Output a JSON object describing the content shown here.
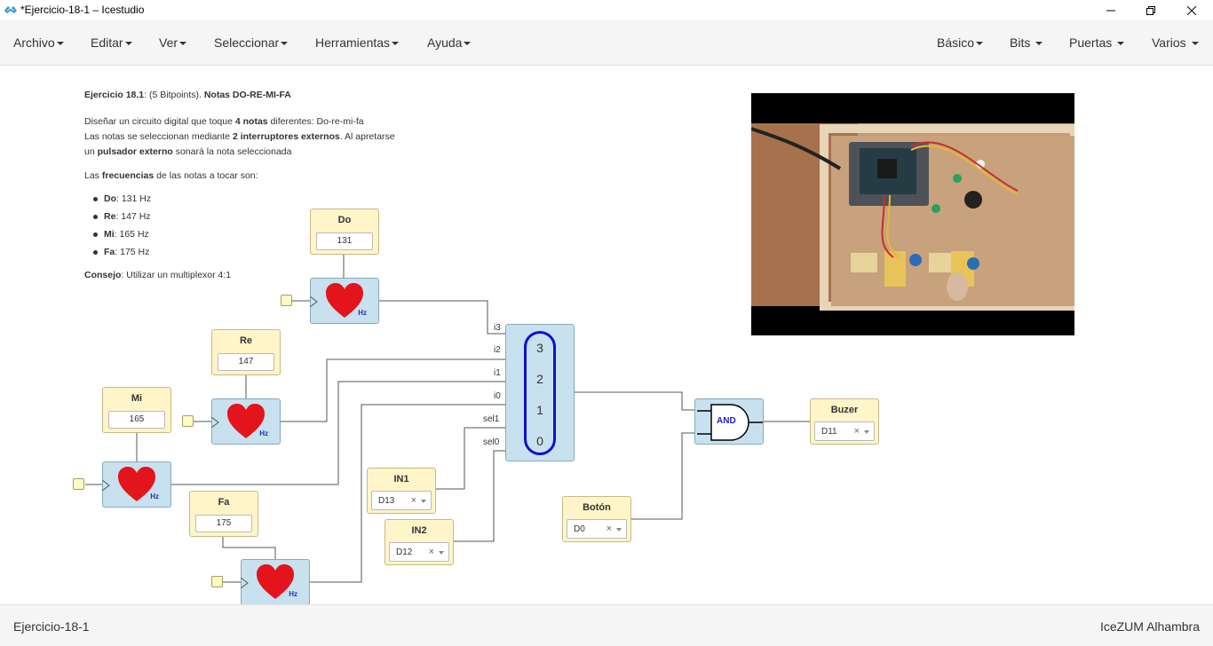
{
  "window": {
    "title": "*Ejercicio-18-1 – Icestudio"
  },
  "menubar": {
    "left": [
      "Archivo",
      "Editar",
      "Ver",
      "Seleccionar",
      "Herramientas",
      "Ayuda"
    ],
    "right": [
      "Básico",
      "Bits",
      "Puertas",
      "Varios"
    ]
  },
  "info": {
    "title_prefix": "Ejercicio 18.1",
    "title_mid": ": (5 Bitpoints). ",
    "title_suffix": "Notas DO-RE-MI-FA",
    "p1_a": "Diseñar un circuito digital que toque ",
    "p1_b": "4 notas",
    "p1_c": " diferentes: Do-re-mi-fa",
    "p2_a": "Las notas se seleccionan mediante ",
    "p2_b": "2 interruptores externos",
    "p2_c": ". Al apretarse",
    "p3_a": "un ",
    "p3_b": "pulsador externo",
    "p3_c": " sonará la nota seleccionada",
    "freq_a": "Las ",
    "freq_b": "frecuencias",
    "freq_c": " de las notas a tocar son:",
    "notes": [
      {
        "name": "Do",
        "freq": ": 131 Hz"
      },
      {
        "name": "Re",
        "freq": ": 147 Hz"
      },
      {
        "name": "Mi",
        "freq": ": 165 Hz"
      },
      {
        "name": "Fa",
        "freq": ": 175 Hz"
      }
    ],
    "tip_a": "Consejo",
    "tip_b": ": Utilizar un multiplexor 4:1"
  },
  "constants": {
    "do": {
      "label": "Do",
      "value": "131"
    },
    "re": {
      "label": "Re",
      "value": "147"
    },
    "mi": {
      "label": "Mi",
      "value": "165"
    },
    "fa": {
      "label": "Fa",
      "value": "175"
    }
  },
  "heart_unit": "Hz",
  "mux": {
    "numbers": [
      "3",
      "2",
      "1",
      "0"
    ],
    "pins": [
      "i3",
      "i2",
      "i1",
      "i0",
      "sel1",
      "sel0"
    ]
  },
  "and_gate": {
    "label": "AND"
  },
  "inputs": {
    "in1": {
      "label": "IN1",
      "pin": "D13"
    },
    "in2": {
      "label": "IN2",
      "pin": "D12"
    },
    "boton": {
      "label": "Botón",
      "pin": "D0"
    }
  },
  "outputs": {
    "buzer": {
      "label": "Buzer",
      "pin": "D11"
    }
  },
  "select_clear": "×",
  "colors": {
    "constant_bg": "#fff5c8",
    "block_bg": "#c7e1ee",
    "mux_outline": "#1010d0",
    "heart": "#e3141b",
    "wire": "#555555"
  },
  "statusbar": {
    "left": "Ejercicio-18-1",
    "right": "IceZUM Alhambra"
  }
}
